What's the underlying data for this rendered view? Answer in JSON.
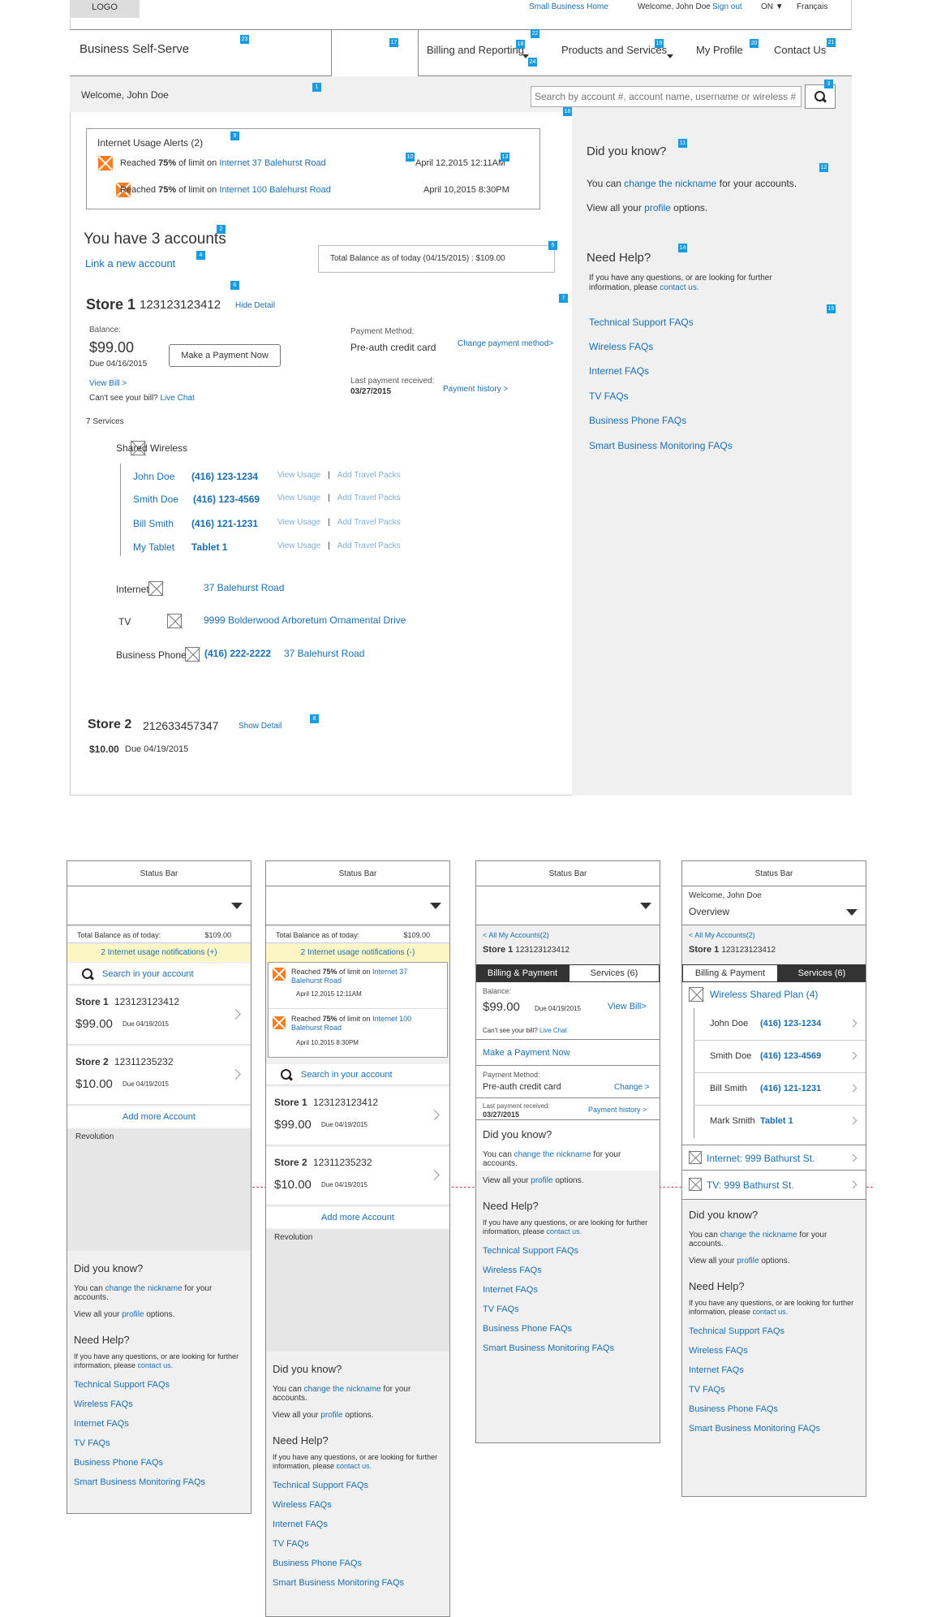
{
  "header": {
    "logo": "LOGO",
    "small_business_home": "Small Business Home",
    "welcome": "Welcome, John Doe",
    "sign_out": "Sign out",
    "province": "ON ▼",
    "francais": "Français"
  },
  "nav": {
    "business_self_serve": "Business Self-Serve",
    "billing": "Billing and Reporting",
    "products": "Products and Services",
    "profile": "My Profile",
    "contact": "Contact Us"
  },
  "welcome_bar": {
    "text": "Welcome,  John Doe",
    "search_placeholder": "Search by account #, account name, username or wireless #"
  },
  "alerts": {
    "title": "Internet Usage Alerts (2)",
    "items": [
      {
        "pre": "Reached ",
        "bold": "75%",
        "mid": " of limit on ",
        "link": "Internet 37 Balehurst Road",
        "date": "April 12,2015  12:11AM"
      },
      {
        "pre": "Reached ",
        "bold": "75%",
        "mid": " of limit on ",
        "link": "Internet 100 Balehurst Road",
        "date": "April 10,2015 8:30PM"
      }
    ]
  },
  "accounts": {
    "heading": "You have 3 accounts",
    "link_new": "Link a new account",
    "total_balance": "Total Balance as of today (04/15/2015) :   $109.00"
  },
  "store1": {
    "name": "Store 1",
    "number": "123123123412",
    "hide": "Hide Detail",
    "balance_label": "Balance:",
    "balance": "$99.00",
    "due": "Due 04/16/2015",
    "pay_btn": "Make a Payment Now",
    "view_bill": "View Bill >",
    "cant_see": "Can't see your bill?",
    "live_chat": "Live Chat",
    "pm_label": "Payment Method:",
    "pm_value": "Pre-auth credit card",
    "change_pm": "Change payment method>",
    "last_label": "Last payment received:",
    "last_date": "03/27/2015",
    "history": "Payment history >",
    "services_count": "7 Services",
    "shared": "Shared Wireless",
    "lines": [
      {
        "name": "John Doe",
        "num": "(416) 123-1234"
      },
      {
        "name": "Smith Doe",
        "num": "(416) 123-4569"
      },
      {
        "name": "Bill Smith",
        "num": "(416) 121-1231"
      },
      {
        "name": "My Tablet",
        "num": "Tablet 1"
      }
    ],
    "view_usage": "View Usage",
    "sep": "|",
    "travel": "Add Travel Packs",
    "internet": "Internet",
    "internet_addr": "37 Balehurst Road",
    "tv": "TV",
    "tv_addr": "9999 Bolderwood Arboretum Ornamental Drive",
    "phone": "Business Phone",
    "phone_num": "(416) 222-2222",
    "phone_addr": "37 Balehurst Road"
  },
  "store2": {
    "name": "Store 2",
    "number": "212633457347",
    "show": "Show Detail",
    "amount": "$10.00",
    "due": "Due 04/19/2015"
  },
  "side": {
    "dyk": "Did you know?",
    "you_can": "You can ",
    "change_nick": "change the nickname",
    "for_accounts": " for your accounts.",
    "view_all": "View all your ",
    "profile": "profile",
    "options": " options.",
    "need_help": "Need Help?",
    "help_text": "If you have any questions, or are looking for further information, please ",
    "contact_us": "contact us.",
    "faqs": [
      "Technical Support FAQs",
      "Wireless FAQs",
      "Internet FAQs",
      "TV FAQs",
      "Business Phone FAQs",
      "Smart Business Monitoring FAQs"
    ]
  },
  "badges": [
    "1",
    "2",
    "3",
    "4",
    "5",
    "6",
    "7",
    "8",
    "9",
    "10",
    "11",
    "12",
    "13",
    "14",
    "15",
    "16",
    "17",
    "18",
    "19",
    "20",
    "21",
    "22",
    "23",
    "24"
  ],
  "mobile": {
    "status_bar": "Status Bar",
    "total_label": "Total Balance as of today:",
    "total_value": "$109.00",
    "notif_collapsed": "2 Internet usage notifications (+)",
    "notif_expanded": "2 Internet usage notifications (-)",
    "search": "Search in your account",
    "store1_name": "Store 1",
    "store1_num": "123123123412",
    "store1_amt": "$99.00",
    "store1_due": "Due 04/19/2015",
    "store2_name": "Store 2",
    "store2_num": "12311235232",
    "store2_amt": "$10.00",
    "store2_due": "Due 04/19/2015",
    "add_more": "Add more Account",
    "revolution": "Revolution",
    "alert1_date": "April 12,2015 12:11AM",
    "alert2_date": "April 10,2015 8:30PM",
    "alert1_link": "Internet 37 Balehurst Road",
    "alert2_link": "Internet 100 Balehurst Road",
    "all_accounts": "< All My Accounts(2)",
    "tab_billing": "Billing & Payment",
    "tab_services": "Services (6)",
    "balance_label": "Balance:",
    "view_bill": "View Bill>",
    "cant_see": "Can't see your bill?",
    "live_chat": "Live Chat",
    "make_payment": "Make a Payment Now",
    "pm_label": "Payment Method:",
    "pm_value": "Pre-auth credit card",
    "change": "Change  >",
    "last_label": "Last payment received:",
    "last_date": "03/27/2015",
    "history": "Payment history >",
    "welcome": "Welcome,  John Doe",
    "overview": "Overview",
    "shared_plan": "Wireless Shared Plan (4)",
    "lines": [
      {
        "name": "John Doe",
        "num": "(416) 123-1234"
      },
      {
        "name": "Smith Doe",
        "num": "(416) 123-4569"
      },
      {
        "name": "Bill Smith",
        "num": "(416) 121-1231"
      },
      {
        "name": "Mark Smith",
        "num": "Tablet 1"
      }
    ],
    "internet": "Internet:  999 Bathurst St.",
    "tv": "TV:  999 Bathurst St."
  }
}
